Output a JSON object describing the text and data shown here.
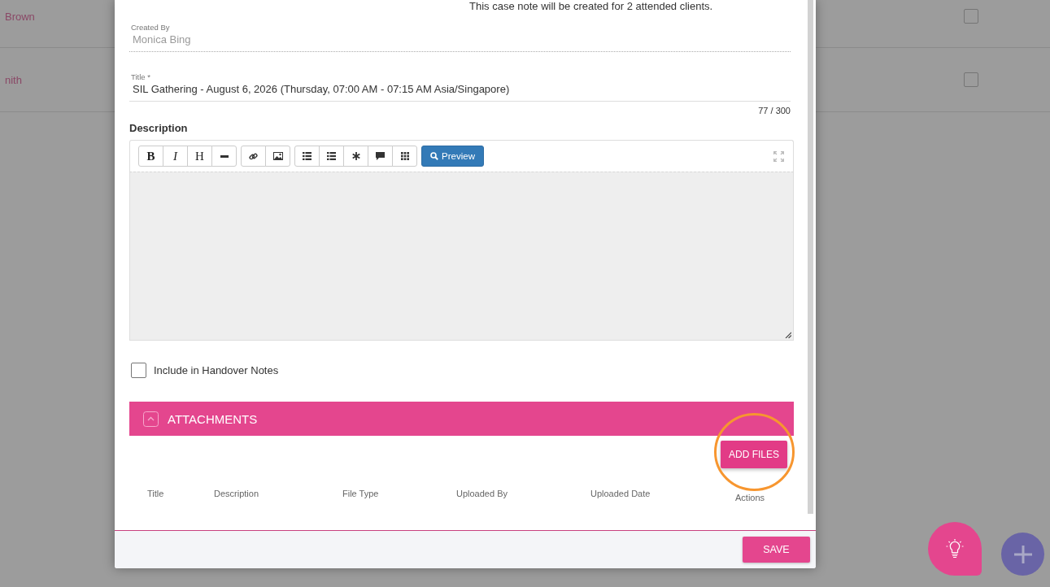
{
  "background_list": {
    "rows": [
      {
        "name": "Brown",
        "checked": false
      },
      {
        "name": "nith",
        "checked": false
      }
    ]
  },
  "dialog": {
    "notice": "This case note will be created for 2 attended clients.",
    "created_by": {
      "label": "Created By",
      "value": "Monica Bing"
    },
    "title_field": {
      "label": "Title *",
      "value": "SIL Gathering - August 6, 2026 (Thursday, 07:00 AM - 07:15 AM Asia/Singapore)",
      "counter": "77 / 300"
    },
    "description": {
      "label": "Description",
      "toolbar": [
        [
          {
            "kind": "bold",
            "label": "B"
          },
          {
            "kind": "italic",
            "label": "I"
          },
          {
            "kind": "heading",
            "label": "H"
          },
          {
            "kind": "rule"
          }
        ],
        [
          {
            "kind": "link"
          },
          {
            "kind": "image"
          }
        ],
        [
          {
            "kind": "bullets"
          },
          {
            "kind": "numbers"
          },
          {
            "kind": "asterisk"
          },
          {
            "kind": "quote"
          },
          {
            "kind": "table"
          }
        ]
      ],
      "preview_button": "Preview"
    },
    "handover": {
      "label": "Include in Handover Notes",
      "checked": false
    },
    "attachments": {
      "title": "ATTACHMENTS",
      "expanded": true,
      "add_button": "ADD FILES",
      "columns": [
        "Title",
        "Description",
        "File Type",
        "Uploaded By",
        "Uploaded Date",
        "Actions"
      ]
    },
    "save_button": "SAVE"
  }
}
